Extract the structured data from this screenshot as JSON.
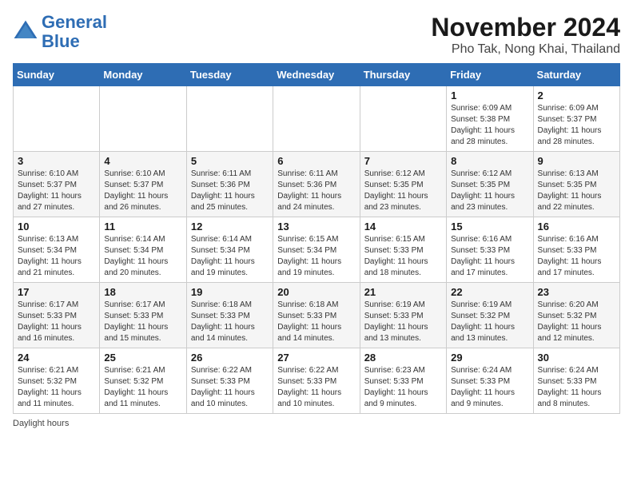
{
  "header": {
    "logo_line1": "General",
    "logo_line2": "Blue",
    "month": "November 2024",
    "location": "Pho Tak, Nong Khai, Thailand"
  },
  "days_of_week": [
    "Sunday",
    "Monday",
    "Tuesday",
    "Wednesday",
    "Thursday",
    "Friday",
    "Saturday"
  ],
  "weeks": [
    [
      {
        "day": "",
        "info": ""
      },
      {
        "day": "",
        "info": ""
      },
      {
        "day": "",
        "info": ""
      },
      {
        "day": "",
        "info": ""
      },
      {
        "day": "",
        "info": ""
      },
      {
        "day": "1",
        "info": "Sunrise: 6:09 AM\nSunset: 5:38 PM\nDaylight: 11 hours and 28 minutes."
      },
      {
        "day": "2",
        "info": "Sunrise: 6:09 AM\nSunset: 5:37 PM\nDaylight: 11 hours and 28 minutes."
      }
    ],
    [
      {
        "day": "3",
        "info": "Sunrise: 6:10 AM\nSunset: 5:37 PM\nDaylight: 11 hours and 27 minutes."
      },
      {
        "day": "4",
        "info": "Sunrise: 6:10 AM\nSunset: 5:37 PM\nDaylight: 11 hours and 26 minutes."
      },
      {
        "day": "5",
        "info": "Sunrise: 6:11 AM\nSunset: 5:36 PM\nDaylight: 11 hours and 25 minutes."
      },
      {
        "day": "6",
        "info": "Sunrise: 6:11 AM\nSunset: 5:36 PM\nDaylight: 11 hours and 24 minutes."
      },
      {
        "day": "7",
        "info": "Sunrise: 6:12 AM\nSunset: 5:35 PM\nDaylight: 11 hours and 23 minutes."
      },
      {
        "day": "8",
        "info": "Sunrise: 6:12 AM\nSunset: 5:35 PM\nDaylight: 11 hours and 23 minutes."
      },
      {
        "day": "9",
        "info": "Sunrise: 6:13 AM\nSunset: 5:35 PM\nDaylight: 11 hours and 22 minutes."
      }
    ],
    [
      {
        "day": "10",
        "info": "Sunrise: 6:13 AM\nSunset: 5:34 PM\nDaylight: 11 hours and 21 minutes."
      },
      {
        "day": "11",
        "info": "Sunrise: 6:14 AM\nSunset: 5:34 PM\nDaylight: 11 hours and 20 minutes."
      },
      {
        "day": "12",
        "info": "Sunrise: 6:14 AM\nSunset: 5:34 PM\nDaylight: 11 hours and 19 minutes."
      },
      {
        "day": "13",
        "info": "Sunrise: 6:15 AM\nSunset: 5:34 PM\nDaylight: 11 hours and 19 minutes."
      },
      {
        "day": "14",
        "info": "Sunrise: 6:15 AM\nSunset: 5:33 PM\nDaylight: 11 hours and 18 minutes."
      },
      {
        "day": "15",
        "info": "Sunrise: 6:16 AM\nSunset: 5:33 PM\nDaylight: 11 hours and 17 minutes."
      },
      {
        "day": "16",
        "info": "Sunrise: 6:16 AM\nSunset: 5:33 PM\nDaylight: 11 hours and 17 minutes."
      }
    ],
    [
      {
        "day": "17",
        "info": "Sunrise: 6:17 AM\nSunset: 5:33 PM\nDaylight: 11 hours and 16 minutes."
      },
      {
        "day": "18",
        "info": "Sunrise: 6:17 AM\nSunset: 5:33 PM\nDaylight: 11 hours and 15 minutes."
      },
      {
        "day": "19",
        "info": "Sunrise: 6:18 AM\nSunset: 5:33 PM\nDaylight: 11 hours and 14 minutes."
      },
      {
        "day": "20",
        "info": "Sunrise: 6:18 AM\nSunset: 5:33 PM\nDaylight: 11 hours and 14 minutes."
      },
      {
        "day": "21",
        "info": "Sunrise: 6:19 AM\nSunset: 5:33 PM\nDaylight: 11 hours and 13 minutes."
      },
      {
        "day": "22",
        "info": "Sunrise: 6:19 AM\nSunset: 5:32 PM\nDaylight: 11 hours and 13 minutes."
      },
      {
        "day": "23",
        "info": "Sunrise: 6:20 AM\nSunset: 5:32 PM\nDaylight: 11 hours and 12 minutes."
      }
    ],
    [
      {
        "day": "24",
        "info": "Sunrise: 6:21 AM\nSunset: 5:32 PM\nDaylight: 11 hours and 11 minutes."
      },
      {
        "day": "25",
        "info": "Sunrise: 6:21 AM\nSunset: 5:32 PM\nDaylight: 11 hours and 11 minutes."
      },
      {
        "day": "26",
        "info": "Sunrise: 6:22 AM\nSunset: 5:33 PM\nDaylight: 11 hours and 10 minutes."
      },
      {
        "day": "27",
        "info": "Sunrise: 6:22 AM\nSunset: 5:33 PM\nDaylight: 11 hours and 10 minutes."
      },
      {
        "day": "28",
        "info": "Sunrise: 6:23 AM\nSunset: 5:33 PM\nDaylight: 11 hours and 9 minutes."
      },
      {
        "day": "29",
        "info": "Sunrise: 6:24 AM\nSunset: 5:33 PM\nDaylight: 11 hours and 9 minutes."
      },
      {
        "day": "30",
        "info": "Sunrise: 6:24 AM\nSunset: 5:33 PM\nDaylight: 11 hours and 8 minutes."
      }
    ]
  ],
  "footer": "Daylight hours"
}
